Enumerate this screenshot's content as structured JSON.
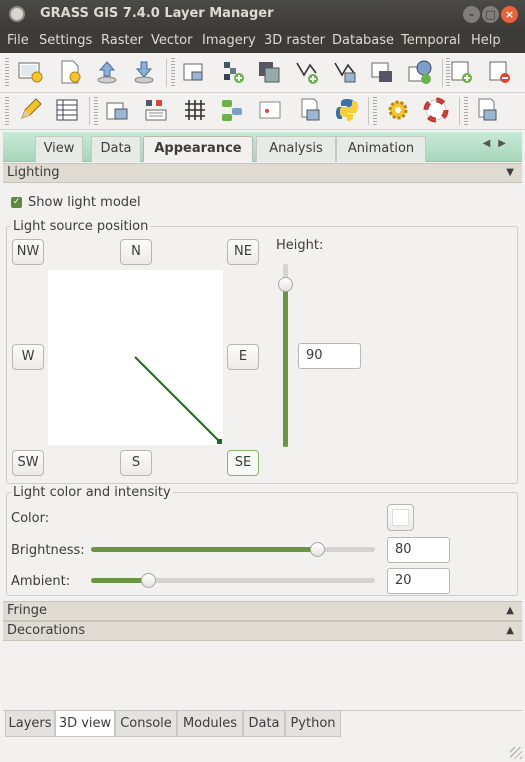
{
  "window": {
    "title": "GRASS GIS 7.4.0 Layer Manager"
  },
  "menubar": [
    "File",
    "Settings",
    "Raster",
    "Vector",
    "Imagery",
    "3D raster",
    "Database",
    "Temporal",
    "Help"
  ],
  "toolbar_icons_row1": [
    "display-map-icon",
    "new-workspace-icon",
    "load-workspace-icon",
    "save-workspace-icon",
    "add-raster-icon",
    "add-rgb-icon",
    "add-shaded-icon",
    "add-vector-icon",
    "add-vector-thematic-icon",
    "add-overlay-icon",
    "add-web-service-icon",
    "add-group-icon",
    "remove-layer-icon"
  ],
  "toolbar_icons_row2": [
    "edit-vector-icon",
    "attribute-table-icon",
    "georectify-icon",
    "graphical-modeler-icon",
    "grid-icon",
    "gui-modules-icon",
    "print-icon",
    "script-icon",
    "python-icon",
    "settings-gear-icon",
    "help-lifebuoy-icon",
    "quit-icon"
  ],
  "tabs": [
    {
      "label": "View",
      "active": false
    },
    {
      "label": "Data",
      "active": false
    },
    {
      "label": "Appearance",
      "active": true
    },
    {
      "label": "Analysis",
      "active": false
    },
    {
      "label": "Animation",
      "active": false
    }
  ],
  "lighting": {
    "header": "Lighting",
    "show_light_model_label": "Show light model",
    "show_light_model_checked": true,
    "position_group_label": "Light source position",
    "directions": {
      "nw": "NW",
      "n": "N",
      "ne": "NE",
      "w": "W",
      "e": "E",
      "sw": "SW",
      "s": "S",
      "se": "SE"
    },
    "selected_direction": "SE",
    "height_label": "Height:",
    "height_value": "90",
    "color_group_label": "Light color and intensity",
    "color_label": "Color:",
    "color_value": "#ffffff",
    "brightness_label": "Brightness:",
    "brightness_value": "80",
    "ambient_label": "Ambient:",
    "ambient_value": "20",
    "accent_color": "#6b9545"
  },
  "fringe": {
    "header": "Fringe"
  },
  "decorations": {
    "header": "Decorations"
  },
  "bottom_tabs": [
    {
      "label": "Layers",
      "active": false
    },
    {
      "label": "3D view",
      "active": true
    },
    {
      "label": "Console",
      "active": false
    },
    {
      "label": "Modules",
      "active": false
    },
    {
      "label": "Data",
      "active": false
    },
    {
      "label": "Python",
      "active": false
    }
  ]
}
